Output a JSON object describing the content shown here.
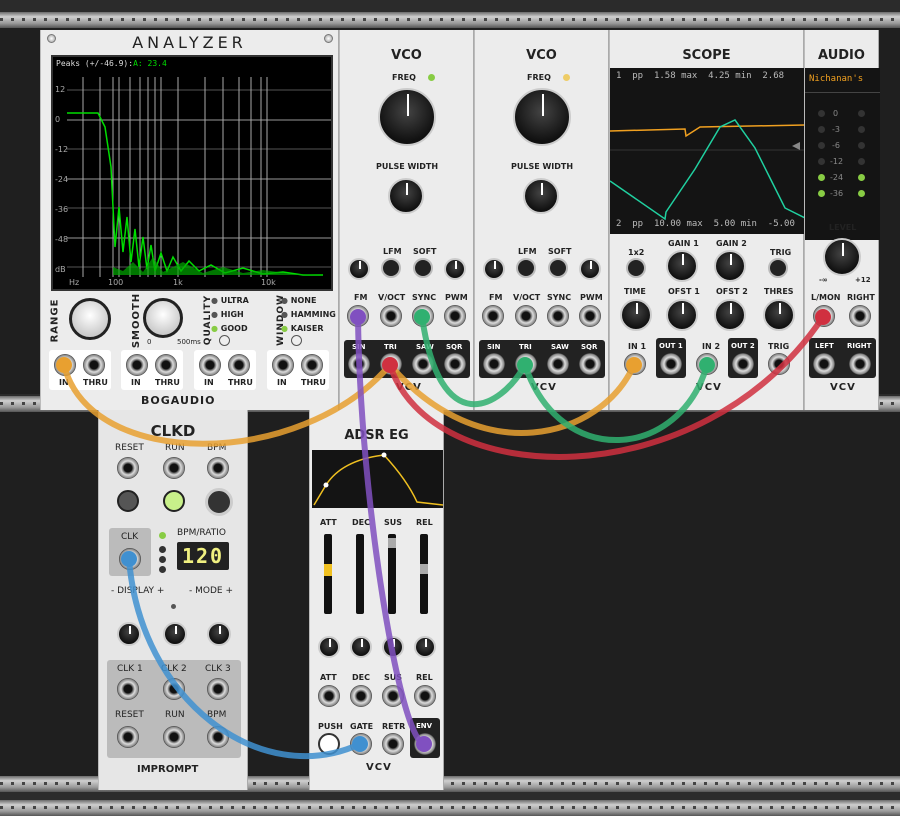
{
  "analyzer": {
    "title": "ANALYZER",
    "readout_label": "Peaks (+/-46.9):",
    "readout_channel": "A:",
    "readout_value": "23.4",
    "y_ticks": [
      "12",
      "0",
      "-12",
      "-24",
      "-36",
      "-48",
      "dB"
    ],
    "x_ticks": [
      "Hz",
      "100",
      "1k",
      "10k"
    ],
    "range_label": "RANGE",
    "smooth_label": "SMOOTH",
    "smooth_min": "0",
    "smooth_max": "500ms",
    "quality_label": "QUALITY",
    "quality_options": [
      "ULTRA",
      "HIGH",
      "GOOD"
    ],
    "window_label": "WINDOW",
    "window_options": [
      "NONE",
      "HAMMING",
      "KAISER"
    ],
    "in_label": "IN",
    "thru_label": "THRU",
    "brand": "BOGAUDIO",
    "spectrum_color": "#00dd00"
  },
  "vco1": {
    "title": "VCO",
    "freq": "FREQ",
    "pw": "PULSE WIDTH",
    "lfm": "LFM",
    "soft": "SOFT",
    "fm": "FM",
    "voct": "V/OCT",
    "sync": "SYNC",
    "pwm": "PWM",
    "sin": "SIN",
    "tri": "TRI",
    "saw": "SAW",
    "sqr": "SQR"
  },
  "vco2": {
    "title": "VCO",
    "freq": "FREQ",
    "pw": "PULSE WIDTH",
    "lfm": "LFM",
    "soft": "SOFT",
    "fm": "FM",
    "voct": "V/OCT",
    "sync": "SYNC",
    "pwm": "PWM",
    "sin": "SIN",
    "tri": "TRI",
    "saw": "SAW",
    "sqr": "SQR"
  },
  "scope": {
    "title": "SCOPE",
    "top_readout": {
      "ch": "1",
      "pp": "pp",
      "pp_val": "1.58",
      "max_lbl": "max",
      "max_val": "4.25",
      "min_lbl": "min",
      "min_val": "2.68"
    },
    "bottom_readout": {
      "ch": "2",
      "pp": "pp",
      "pp_val": "10.00",
      "max_lbl": "max",
      "max_val": "5.00",
      "min_lbl": "min",
      "min_val": "-5.00"
    },
    "x1x2": "1x2",
    "gain1": "GAIN 1",
    "gain2": "GAIN 2",
    "trig": "TRIG",
    "time": "TIME",
    "ofst1": "OFST 1",
    "ofst2": "OFST 2",
    "thres": "THRES",
    "in1": "IN 1",
    "out1": "OUT 1",
    "in2": "IN 2",
    "out2": "OUT 2",
    "trig_in": "TRIG",
    "trace1_color": "#f0a020",
    "trace2_color": "#20d0a0"
  },
  "audio": {
    "title": "AUDIO",
    "device": "Nichanan's",
    "meter": [
      "0",
      "-3",
      "-6",
      "-12",
      "-24",
      "-36"
    ],
    "level": "LEVEL",
    "level_min": "-∞",
    "level_max": "+12",
    "lmon": "L/MON",
    "right": "RIGHT",
    "left_out": "LEFT",
    "right_out": "RIGHT"
  },
  "clkd": {
    "title": "CLKD",
    "reset": "RESET",
    "run": "RUN",
    "bpm": "BPM",
    "clk": "CLK",
    "bpm_ratio": "BPM/RATIO",
    "display_value": "120",
    "display_minus": "-",
    "display_label": "DISPLAY",
    "display_plus": "+",
    "mode_minus": "-",
    "mode_label": "MODE",
    "mode_plus": "+",
    "clk1": "CLK 1",
    "clk2": "CLK 2",
    "clk3": "CLK 3",
    "reset_out": "RESET",
    "run_out": "RUN",
    "bpm_out": "BPM",
    "brand": "IMPROMPT"
  },
  "adsr": {
    "title": "ADSR EG",
    "att": "ATT",
    "dec": "DEC",
    "sus": "SUS",
    "rel": "REL",
    "att2": "ATT",
    "dec2": "DEC",
    "sus2": "SUS",
    "rel2": "REL",
    "push": "PUSH",
    "gate": "GATE",
    "retr": "RETR",
    "env": "ENV"
  },
  "logo": "VCV",
  "colors": {
    "orange": "#e8a030",
    "green": "#30b070",
    "purple": "#8050c0",
    "red": "#d03040",
    "blue": "#4090d0"
  }
}
